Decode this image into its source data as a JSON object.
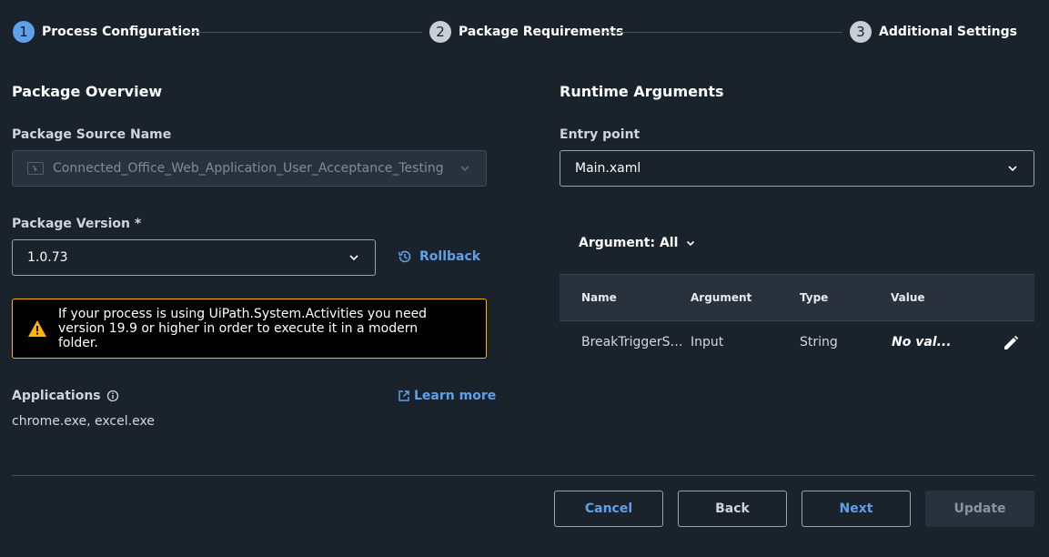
{
  "stepper": {
    "steps": [
      {
        "number": "1",
        "label": "Process Configuration"
      },
      {
        "number": "2",
        "label": "Package Requirements"
      },
      {
        "number": "3",
        "label": "Additional Settings"
      }
    ]
  },
  "overview": {
    "title": "Package Overview",
    "source_label": "Package Source Name",
    "source_value": "Connected_Office_Web_Application_User_Acceptance_Testing",
    "version_label": "Package Version *",
    "version_value": "1.0.73",
    "rollback_label": "Rollback",
    "warning_text": "If your process is using UiPath.System.Activities you need version 19.9 or higher in order to execute it in a modern folder.",
    "applications_label": "Applications",
    "applications_value": "chrome.exe, excel.exe",
    "learn_more_label": "Learn more"
  },
  "runtime": {
    "title": "Runtime Arguments",
    "entry_label": "Entry point",
    "entry_value": "Main.xaml",
    "argument_filter": "Argument: All",
    "columns": [
      "Name",
      "Argument",
      "Type",
      "Value"
    ],
    "rows": [
      {
        "name": "BreakTriggerSco...",
        "argument": "Input",
        "type": "String",
        "value": "No val..."
      }
    ]
  },
  "footer": {
    "cancel": "Cancel",
    "back": "Back",
    "next": "Next",
    "update": "Update"
  },
  "colors": {
    "background": "#1a222b",
    "accent": "#5fa0ea",
    "warning": "#ffb40a"
  }
}
